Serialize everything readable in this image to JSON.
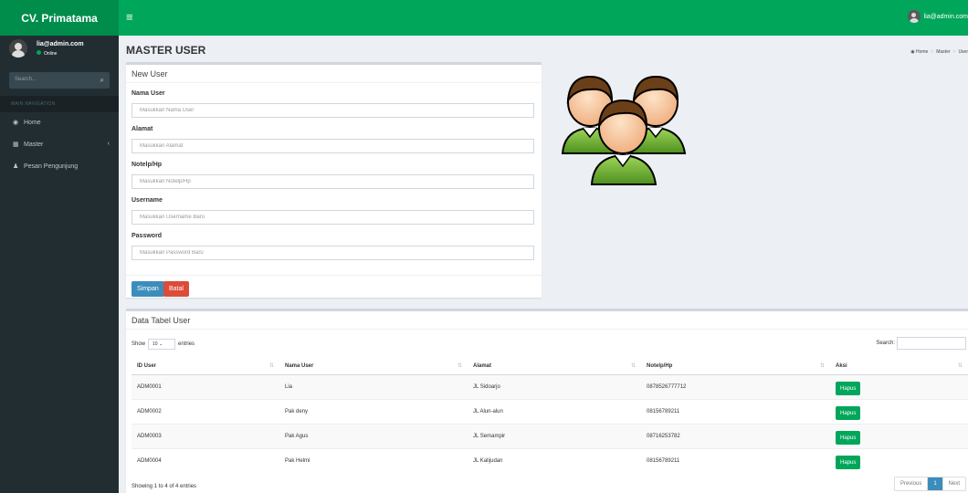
{
  "header": {
    "logo": "CV. Primatama",
    "menu_icon": "≡",
    "user_email": "lia@admin.com"
  },
  "sidebar": {
    "user_name": "lia@admin.com",
    "user_status": "Online",
    "search_placeholder": "Search...",
    "nav_header": "MAIN NAVIGATION",
    "items": [
      {
        "label": "Home",
        "icon": "dashboard-icon"
      },
      {
        "label": "Master",
        "icon": "table-icon"
      },
      {
        "label": "Pesan Pengunjung",
        "icon": "user-icon"
      }
    ]
  },
  "page": {
    "title": "MASTER USER",
    "breadcrumb": [
      "Home",
      "Master",
      "User"
    ]
  },
  "form": {
    "title": "New User",
    "fields": [
      {
        "label": "Nama User",
        "placeholder": "Masukkan Nama User"
      },
      {
        "label": "Alamat",
        "placeholder": "Masukkan Alamat"
      },
      {
        "label": "Notelp/Hp",
        "placeholder": "Masukkan Notelp/Hp"
      },
      {
        "label": "Username",
        "placeholder": "Masukkan Username Baru"
      },
      {
        "label": "Password",
        "placeholder": "Masukkan Password Baru"
      }
    ],
    "save_label": "Simpan",
    "cancel_label": "Batal"
  },
  "table": {
    "title": "Data Tabel User",
    "show_label": "Show",
    "entries_value": "10",
    "entries_label": "entries",
    "search_label": "Search:",
    "columns": [
      "ID User",
      "Nama User",
      "Alamat",
      "Notelp/Hp",
      "Aksi"
    ],
    "rows": [
      {
        "id": "ADM0001",
        "nama": "Lia",
        "alamat": "JL Sidoarjo",
        "telp": "0878526777712",
        "aksi": "Hapus"
      },
      {
        "id": "ADM0002",
        "nama": "Pak deny",
        "alamat": "JL Alun-alun",
        "telp": "08156789211",
        "aksi": "Hapus"
      },
      {
        "id": "ADM0003",
        "nama": "Pak Agus",
        "alamat": "JL Semampir",
        "telp": "08716253782",
        "aksi": "Hapus"
      },
      {
        "id": "ADM0004",
        "nama": "Pak Helmi",
        "alamat": "JL Kalijudan",
        "telp": "08156789211",
        "aksi": "Hapus"
      }
    ],
    "info": "Showing 1 to 4 of 4 entries",
    "pagination": {
      "previous": "Previous",
      "current": "1",
      "next": "Next"
    }
  },
  "colors": {
    "header_green": "#00a65a",
    "logo_green": "#008d4c",
    "sidebar_bg": "#222d32",
    "primary": "#3c8dbc",
    "danger": "#dd4b39"
  }
}
